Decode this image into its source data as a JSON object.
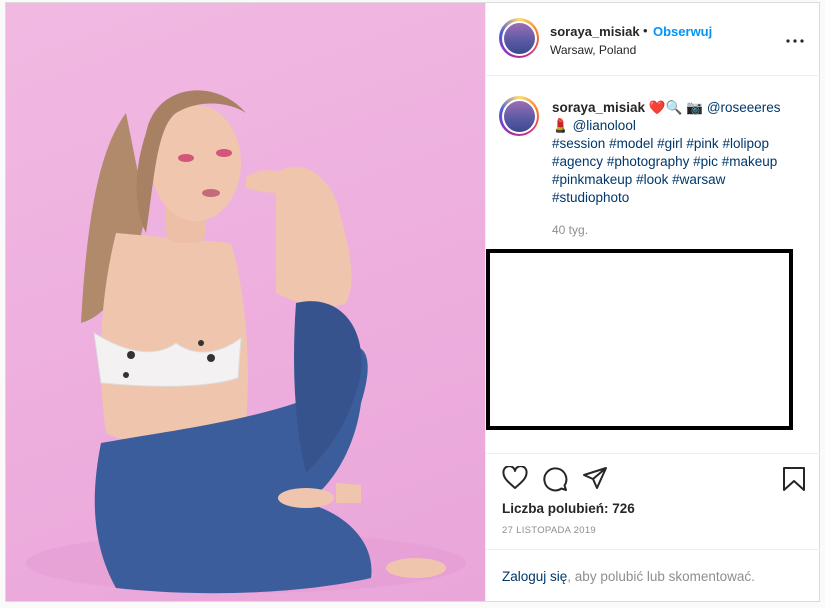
{
  "post": {
    "username": "soraya_misiak",
    "follow_separator": "•",
    "follow_label": "Obserwuj",
    "location": "Warsaw, Poland",
    "more_label": "•••"
  },
  "caption": {
    "username": "soraya_misiak",
    "emoji_heart": "❤️",
    "emoji_search": "🔍",
    "emoji_camera": "📷",
    "mention1": "@roseeeres",
    "emoji_lipstick": "💄",
    "mention2": "@lianolool",
    "hashtags": [
      "#session",
      "#model",
      "#girl",
      "#pink",
      "#lolipop",
      "#agency",
      "#photography",
      "#pic",
      "#makeup",
      "#pinkmakeup",
      "#look",
      "#warsaw",
      "#studiophoto"
    ],
    "time_ago": "40 tyg."
  },
  "actions": {
    "likes_label": "Liczba polubień: 726",
    "date": "27 LISTOPADA 2019"
  },
  "login": {
    "link": "Zaloguj się",
    "rest": ", aby polubić lub skomentować."
  },
  "colors": {
    "photo_background": "#eeb0df",
    "link_blue": "#0095f6",
    "hashtag_navy": "#00376b"
  },
  "icons": [
    "heart-icon",
    "comment-icon",
    "share-icon",
    "bookmark-icon",
    "more-options-icon"
  ]
}
